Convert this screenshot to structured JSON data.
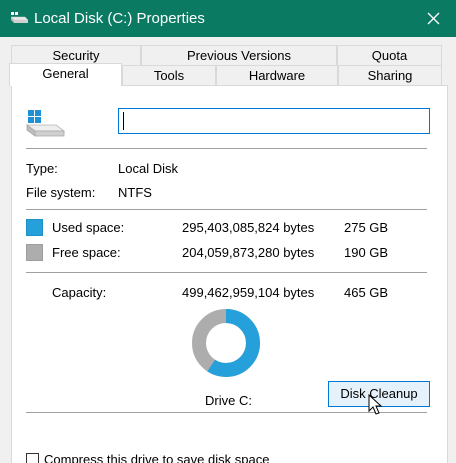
{
  "window": {
    "title": "Local Disk (C:) Properties"
  },
  "tabs": {
    "row1": [
      "Security",
      "Previous Versions",
      "Quota"
    ],
    "row2": [
      "General",
      "Tools",
      "Hardware",
      "Sharing"
    ],
    "active": "General"
  },
  "general": {
    "volume_name_value": "",
    "type_label": "Type:",
    "type_value": "Local Disk",
    "filesystem_label": "File system:",
    "filesystem_value": "NTFS",
    "used_label": "Used space:",
    "used_bytes": "295,403,085,824 bytes",
    "used_gb": "275 GB",
    "free_label": "Free space:",
    "free_bytes": "204,059,873,280 bytes",
    "free_gb": "190 GB",
    "capacity_label": "Capacity:",
    "capacity_bytes": "499,462,959,104 bytes",
    "capacity_gb": "465 GB",
    "used_fraction": 0.5914,
    "drive_label": "Drive C:",
    "cleanup_button": "Disk Cleanup",
    "compress_label": "Compress this drive to save disk space",
    "compress_checked": false
  },
  "colors": {
    "titlebar": "#0a7a62",
    "used": "#26a0da",
    "free": "#adadad",
    "focus": "#0078d7"
  },
  "icons": {
    "title": "drive-icon",
    "close": "close-icon",
    "drive": "drive-icon",
    "cursor": "mouse-pointer-icon"
  }
}
